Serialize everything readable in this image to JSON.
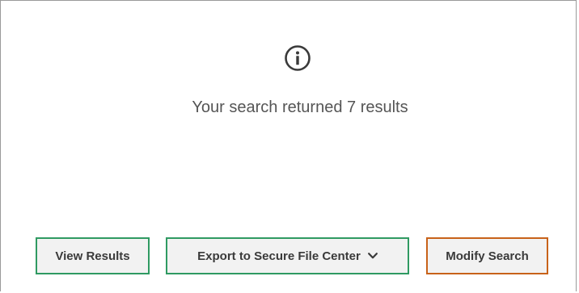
{
  "dialog": {
    "icon": "info-circle-icon",
    "message": "Your search returned 7 results"
  },
  "actions": {
    "view_results_label": "View Results",
    "export_label": "Export to Secure File Center",
    "export_icon": "chevron-down-icon",
    "modify_search_label": "Modify Search"
  },
  "colors": {
    "primary_border": "#2f9a62",
    "secondary_border": "#c8621a",
    "button_bg": "#f2f2f2",
    "text": "#555555"
  }
}
